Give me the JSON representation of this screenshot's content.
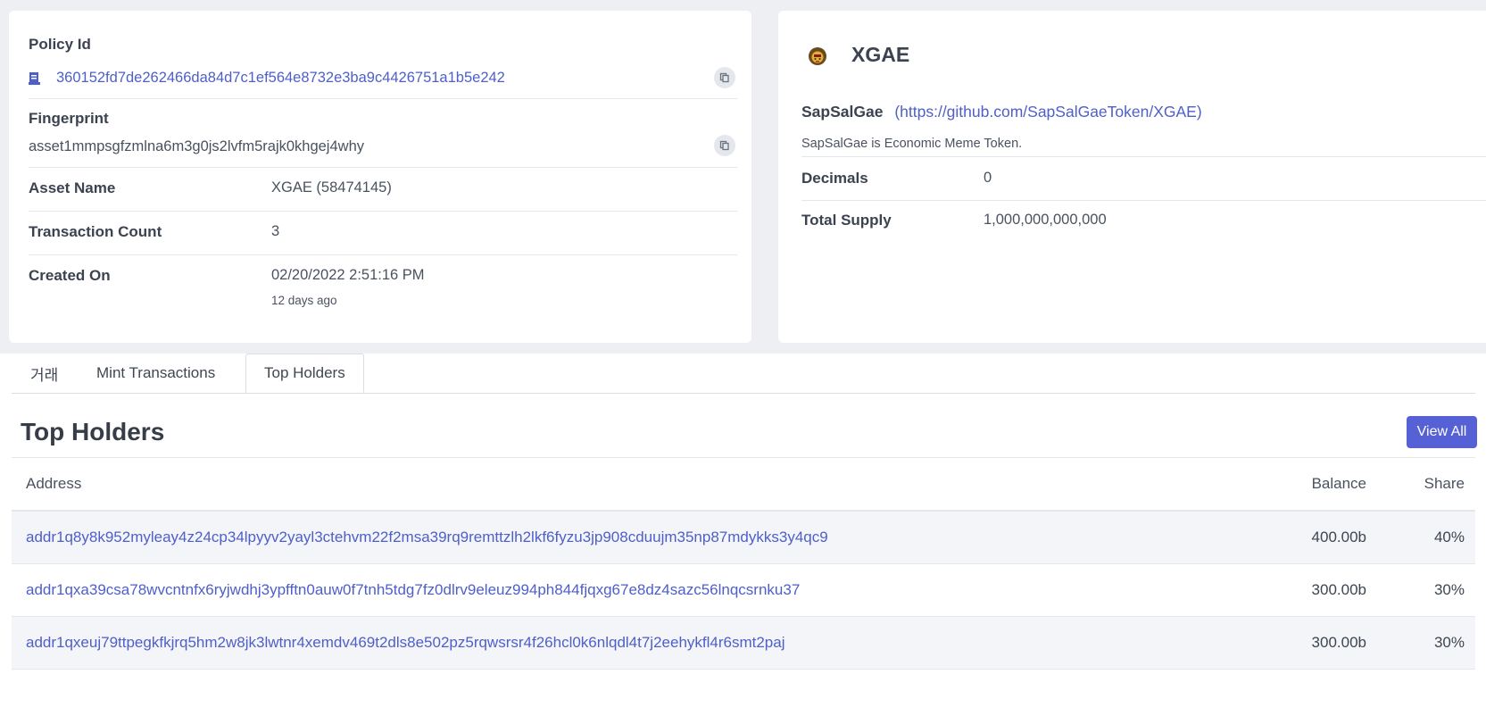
{
  "policy": {
    "label": "Policy Id",
    "value": "360152fd7de262466da84d7c1ef564e8732e3ba9c4426751a1b5e242"
  },
  "fingerprint": {
    "label": "Fingerprint",
    "value": "asset1mmpsgfzmlna6m3g0js2lvfm5rajk0khgej4why"
  },
  "asset_name": {
    "label": "Asset Name",
    "value": "XGAE (58474145)"
  },
  "tx_count": {
    "label": "Transaction Count",
    "value": "3"
  },
  "created_on": {
    "label": "Created On",
    "value": "02/20/2022 2:51:16 PM",
    "relative": "12 days ago"
  },
  "token": {
    "ticker": "XGAE",
    "name": "SapSalGae",
    "url": "(https://github.com/SapSalGaeToken/XGAE)",
    "description": "SapSalGae is Economic Meme Token.",
    "decimals_label": "Decimals",
    "decimals_value": "0",
    "supply_label": "Total Supply",
    "supply_value": "1,000,000,000,000"
  },
  "tabs": [
    {
      "label": "거래"
    },
    {
      "label": "Mint Transactions"
    },
    {
      "label": "Top Holders"
    }
  ],
  "holders": {
    "title": "Top Holders",
    "view_all": "View All",
    "columns": [
      "Address",
      "Balance",
      "Share"
    ],
    "rows": [
      {
        "address": "addr1q8y8k952myleay4z24cp34lpyyv2yayl3ctehvm22f2msa39rq9remttzlh2lkf6fyzu3jp908cduujm35np87mdykks3y4qc9",
        "balance": "400.00b",
        "share": "40%"
      },
      {
        "address": "addr1qxa39csa78wvcntnfx6ryjwdhj3ypfftn0auw0f7tnh5tdg7fz0dlrv9eleuz994ph844fjqxg67e8dz4sazc56lnqcsrnku37",
        "balance": "300.00b",
        "share": "30%"
      },
      {
        "address": "addr1qxeuj79ttpegkfkjrq5hm2w8jk3lwtnr4xemdv469t2dls8e502pz5rqwsrsr4f26hcl0k6nlqdl4t7j2eehykfl4r6smt2paj",
        "balance": "300.00b",
        "share": "30%"
      }
    ]
  },
  "icons": {
    "policy": "script-icon",
    "copy": "copy-icon",
    "token_logo": "sapsalgae-logo"
  },
  "colors": {
    "link": "#4e5fc9",
    "button": "#5661d6",
    "background": "#edeff3"
  }
}
